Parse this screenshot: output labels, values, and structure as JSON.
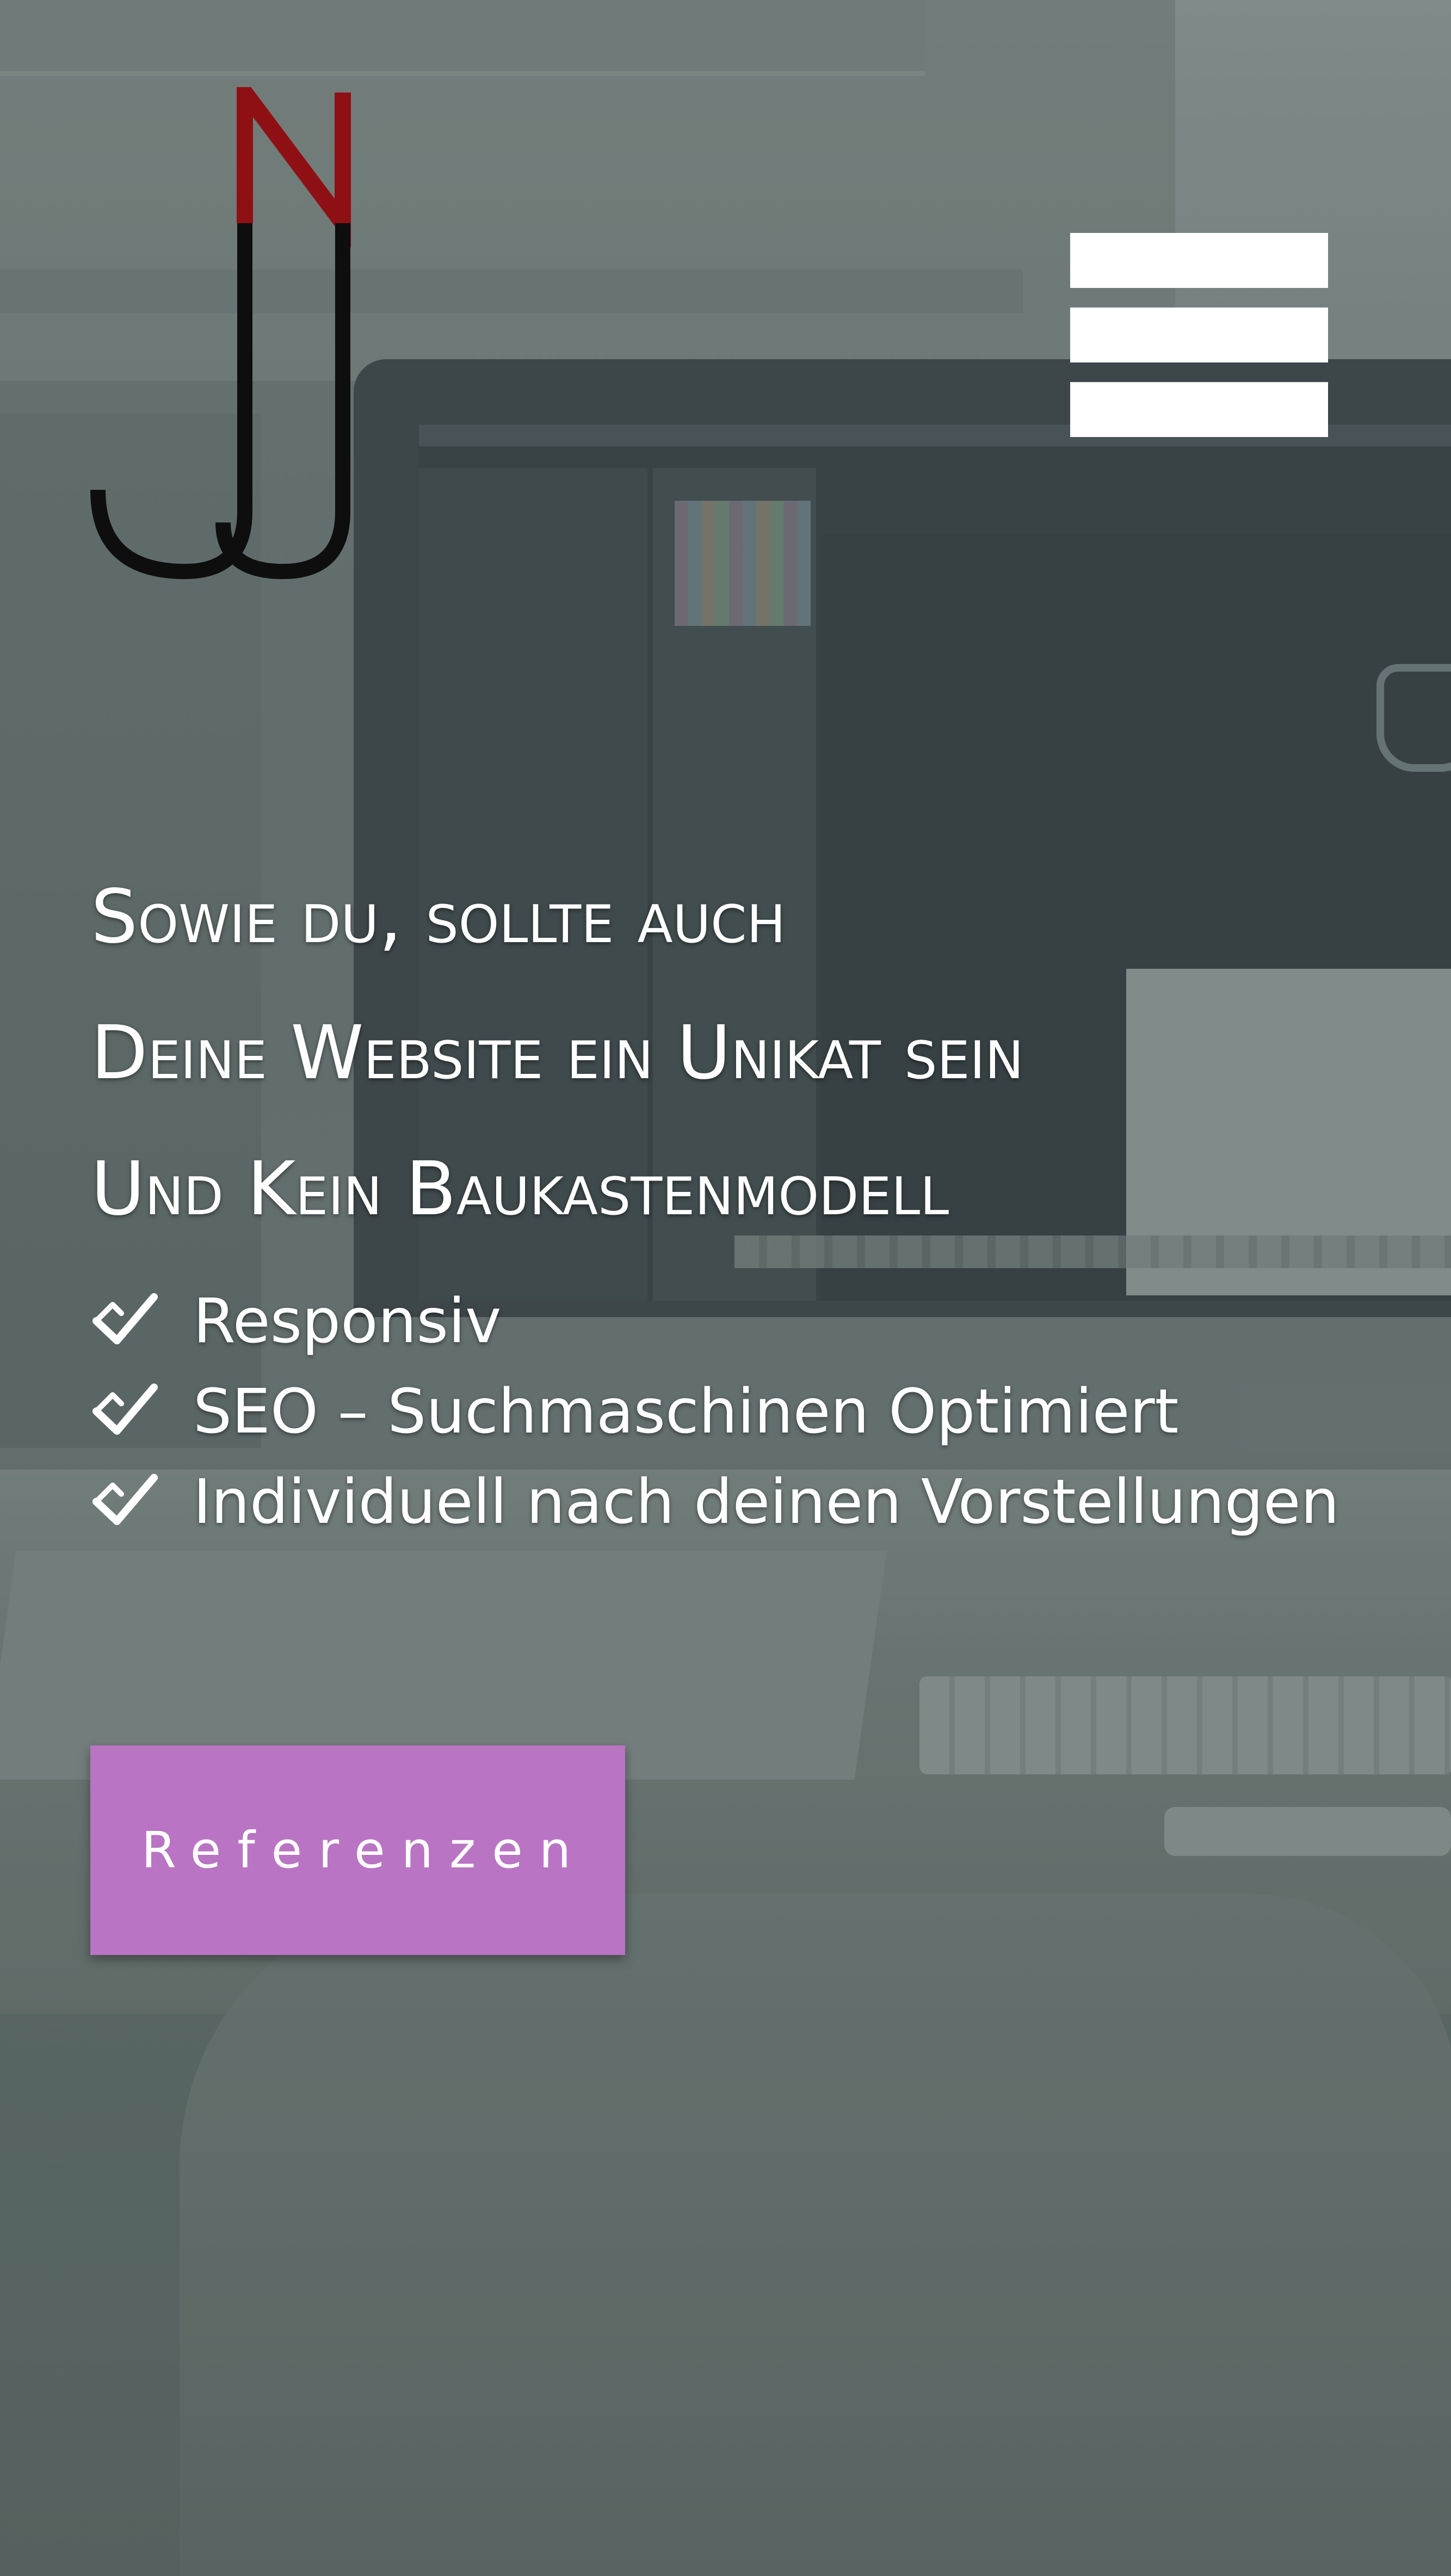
{
  "header": {
    "logo": {
      "icon": "nj-monogram-logo",
      "letters": "NJ",
      "colors": {
        "top": "#8f1014",
        "bottom": "#0e0e0e"
      }
    },
    "menu": {
      "icon": "hamburger-menu-icon",
      "color": "#ffffff"
    }
  },
  "hero": {
    "headline": [
      "Sowie du, sollte auch",
      "Deine Website ein Unikat sein",
      "Und Kein Baukastenmodell"
    ],
    "features": [
      {
        "icon": "checkmark-icon",
        "label": "Responsiv"
      },
      {
        "icon": "checkmark-icon",
        "label": "SEO – Suchmaschinen Optimiert"
      },
      {
        "icon": "checkmark-icon",
        "label": "Individuell nach deinen Vorstellungen"
      }
    ],
    "cta": {
      "label": "Referenzen",
      "color": "#b974c3"
    }
  }
}
